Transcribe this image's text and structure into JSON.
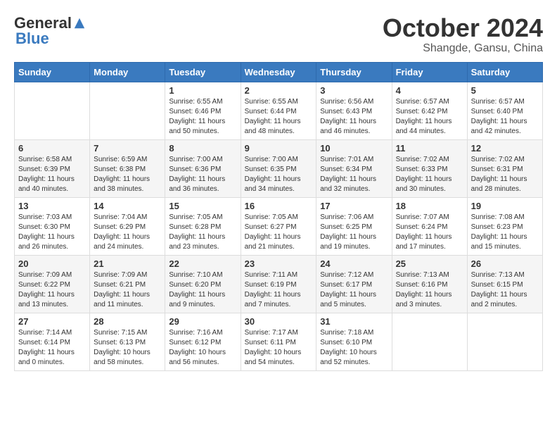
{
  "logo": {
    "general": "General",
    "blue": "Blue"
  },
  "header": {
    "month": "October 2024",
    "location": "Shangde, Gansu, China"
  },
  "weekdays": [
    "Sunday",
    "Monday",
    "Tuesday",
    "Wednesday",
    "Thursday",
    "Friday",
    "Saturday"
  ],
  "weeks": [
    [
      {
        "day": "",
        "info": ""
      },
      {
        "day": "",
        "info": ""
      },
      {
        "day": "1",
        "info": "Sunrise: 6:55 AM\nSunset: 6:46 PM\nDaylight: 11 hours and 50 minutes."
      },
      {
        "day": "2",
        "info": "Sunrise: 6:55 AM\nSunset: 6:44 PM\nDaylight: 11 hours and 48 minutes."
      },
      {
        "day": "3",
        "info": "Sunrise: 6:56 AM\nSunset: 6:43 PM\nDaylight: 11 hours and 46 minutes."
      },
      {
        "day": "4",
        "info": "Sunrise: 6:57 AM\nSunset: 6:42 PM\nDaylight: 11 hours and 44 minutes."
      },
      {
        "day": "5",
        "info": "Sunrise: 6:57 AM\nSunset: 6:40 PM\nDaylight: 11 hours and 42 minutes."
      }
    ],
    [
      {
        "day": "6",
        "info": "Sunrise: 6:58 AM\nSunset: 6:39 PM\nDaylight: 11 hours and 40 minutes."
      },
      {
        "day": "7",
        "info": "Sunrise: 6:59 AM\nSunset: 6:38 PM\nDaylight: 11 hours and 38 minutes."
      },
      {
        "day": "8",
        "info": "Sunrise: 7:00 AM\nSunset: 6:36 PM\nDaylight: 11 hours and 36 minutes."
      },
      {
        "day": "9",
        "info": "Sunrise: 7:00 AM\nSunset: 6:35 PM\nDaylight: 11 hours and 34 minutes."
      },
      {
        "day": "10",
        "info": "Sunrise: 7:01 AM\nSunset: 6:34 PM\nDaylight: 11 hours and 32 minutes."
      },
      {
        "day": "11",
        "info": "Sunrise: 7:02 AM\nSunset: 6:33 PM\nDaylight: 11 hours and 30 minutes."
      },
      {
        "day": "12",
        "info": "Sunrise: 7:02 AM\nSunset: 6:31 PM\nDaylight: 11 hours and 28 minutes."
      }
    ],
    [
      {
        "day": "13",
        "info": "Sunrise: 7:03 AM\nSunset: 6:30 PM\nDaylight: 11 hours and 26 minutes."
      },
      {
        "day": "14",
        "info": "Sunrise: 7:04 AM\nSunset: 6:29 PM\nDaylight: 11 hours and 24 minutes."
      },
      {
        "day": "15",
        "info": "Sunrise: 7:05 AM\nSunset: 6:28 PM\nDaylight: 11 hours and 23 minutes."
      },
      {
        "day": "16",
        "info": "Sunrise: 7:05 AM\nSunset: 6:27 PM\nDaylight: 11 hours and 21 minutes."
      },
      {
        "day": "17",
        "info": "Sunrise: 7:06 AM\nSunset: 6:25 PM\nDaylight: 11 hours and 19 minutes."
      },
      {
        "day": "18",
        "info": "Sunrise: 7:07 AM\nSunset: 6:24 PM\nDaylight: 11 hours and 17 minutes."
      },
      {
        "day": "19",
        "info": "Sunrise: 7:08 AM\nSunset: 6:23 PM\nDaylight: 11 hours and 15 minutes."
      }
    ],
    [
      {
        "day": "20",
        "info": "Sunrise: 7:09 AM\nSunset: 6:22 PM\nDaylight: 11 hours and 13 minutes."
      },
      {
        "day": "21",
        "info": "Sunrise: 7:09 AM\nSunset: 6:21 PM\nDaylight: 11 hours and 11 minutes."
      },
      {
        "day": "22",
        "info": "Sunrise: 7:10 AM\nSunset: 6:20 PM\nDaylight: 11 hours and 9 minutes."
      },
      {
        "day": "23",
        "info": "Sunrise: 7:11 AM\nSunset: 6:19 PM\nDaylight: 11 hours and 7 minutes."
      },
      {
        "day": "24",
        "info": "Sunrise: 7:12 AM\nSunset: 6:17 PM\nDaylight: 11 hours and 5 minutes."
      },
      {
        "day": "25",
        "info": "Sunrise: 7:13 AM\nSunset: 6:16 PM\nDaylight: 11 hours and 3 minutes."
      },
      {
        "day": "26",
        "info": "Sunrise: 7:13 AM\nSunset: 6:15 PM\nDaylight: 11 hours and 2 minutes."
      }
    ],
    [
      {
        "day": "27",
        "info": "Sunrise: 7:14 AM\nSunset: 6:14 PM\nDaylight: 11 hours and 0 minutes."
      },
      {
        "day": "28",
        "info": "Sunrise: 7:15 AM\nSunset: 6:13 PM\nDaylight: 10 hours and 58 minutes."
      },
      {
        "day": "29",
        "info": "Sunrise: 7:16 AM\nSunset: 6:12 PM\nDaylight: 10 hours and 56 minutes."
      },
      {
        "day": "30",
        "info": "Sunrise: 7:17 AM\nSunset: 6:11 PM\nDaylight: 10 hours and 54 minutes."
      },
      {
        "day": "31",
        "info": "Sunrise: 7:18 AM\nSunset: 6:10 PM\nDaylight: 10 hours and 52 minutes."
      },
      {
        "day": "",
        "info": ""
      },
      {
        "day": "",
        "info": ""
      }
    ]
  ]
}
